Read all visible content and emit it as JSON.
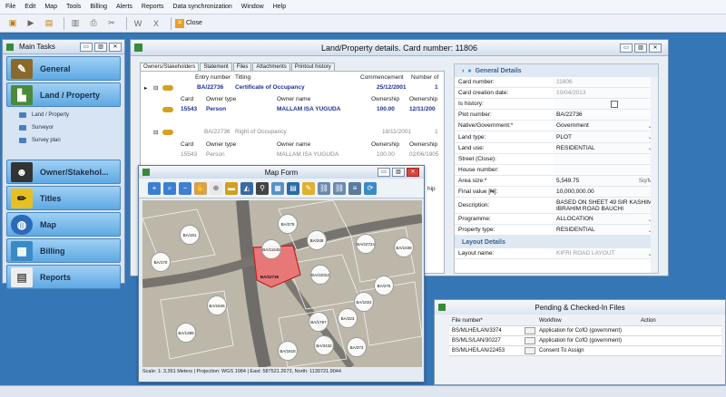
{
  "menu": [
    "File",
    "Edit",
    "Map",
    "Tools",
    "Billing",
    "Alerts",
    "Reports",
    "Data synchronization",
    "Window",
    "Help"
  ],
  "toolbar": {
    "close_label": "Close"
  },
  "main_tasks": {
    "title": "Main Tasks",
    "buttons": {
      "general": "General",
      "land": "Land / Property",
      "owner": "Owner/Stakehol...",
      "titles": "Titles",
      "map": "Map",
      "billing": "Billing",
      "reports": "Reports"
    },
    "land_sub": [
      "Land / Property",
      "Surveyor",
      "Survey plan"
    ]
  },
  "land": {
    "title": "Land/Property details. Card number: 11806",
    "tabs": [
      "Owners/Stakeholders",
      "Statement",
      "Files",
      "Attachments",
      "Printout history"
    ],
    "grid_headers": {
      "entry": "Entry number",
      "titling": "Titling",
      "commencement": "Commencement",
      "number_of": "Number of"
    },
    "entry1": {
      "entry": "BA/22736",
      "titling": "Certificate of Occupancy",
      "commencement": "25/12/2001",
      "number": "1"
    },
    "sub_headers": {
      "card": "Card",
      "owner_type": "Owner type",
      "owner_name": "Owner name",
      "ownership1": "Ownership",
      "ownership2": "Ownership"
    },
    "owner1": {
      "card": "15543",
      "type": "Person",
      "name": "MALLAM ISA  YUGUDA",
      "own1": "100.00",
      "own2": "12/11/200"
    },
    "entry2": {
      "entry": "BA/22736",
      "titling": "Right of Occupancy",
      "commencement": "18/11/2001",
      "number": "1"
    },
    "owner2": {
      "card": "15543",
      "type": "Person",
      "name": "MALLAM ISA  YUGUDA",
      "own1": "100.00",
      "own2": "02/06/1905"
    },
    "right_hdr": "hip",
    "details_section": "General Details",
    "details": [
      {
        "label": "Card number:",
        "value": "11806",
        "grey": true
      },
      {
        "label": "Card creation date:",
        "value": "10/04/2013",
        "grey": true
      },
      {
        "label": "Is history:",
        "value": ""
      },
      {
        "label": "Plot number:",
        "value": "BA/22736"
      },
      {
        "label": "Native/Government:*",
        "value": "Government",
        "dd": true
      },
      {
        "label": "Land type:",
        "value": "PLOT",
        "dd": true
      },
      {
        "label": "Land use:",
        "value": "RESIDENTIAL",
        "dd": true
      },
      {
        "label": "Street (Close):",
        "value": ""
      },
      {
        "label": "House number:",
        "value": ""
      },
      {
        "label": "Area size:*",
        "value": "5,549.75",
        "unit": "Sq/M"
      },
      {
        "label": "Final value [₦]:",
        "value": "10,000,000.00"
      },
      {
        "label": "Description:",
        "value": "BASED ON SHEET 49 SIR KASHIM IBRAHIM ROAD BAUCHI"
      },
      {
        "label": "Programme:",
        "value": "ALLOCATION",
        "dd": true
      },
      {
        "label": "Property type:",
        "value": "RESIDENTIAL",
        "dd": true
      }
    ],
    "layout_section": "Layout Details",
    "layout_name_label": "Layout name:",
    "layout_name_value": "KIFRI ROAD LAYOUT"
  },
  "map_form": {
    "title": "Map Form",
    "status": "Scale: 1: 3,361  Meters  | Projection: WGS 1984 | East: 587521.2673, North: 1139721.9044",
    "plots": [
      "BA/181",
      "BA/378",
      "BA/345",
      "BA/22724",
      "BA/11645",
      "BA/1038",
      "BA/22022",
      "BA/22736",
      "BA/275",
      "BA/1024",
      "BA/1797",
      "BA/323",
      "BA/1399",
      "BA/1646",
      "BA/3432",
      "BA/1818",
      "BA/373",
      "BA/170"
    ]
  },
  "pending": {
    "title": "Pending & Checked-In Files",
    "headers": [
      "File number*",
      "Workflow",
      "Action"
    ],
    "rows": [
      [
        "BS/MLHE/LAN/3374",
        "Application for CofO (government)",
        ""
      ],
      [
        "BS/MLS/LAN/30227",
        "Application for CofO (government)",
        ""
      ],
      [
        "BS/MLHE/LAN/22453",
        "Consent To Assign",
        ""
      ]
    ]
  }
}
